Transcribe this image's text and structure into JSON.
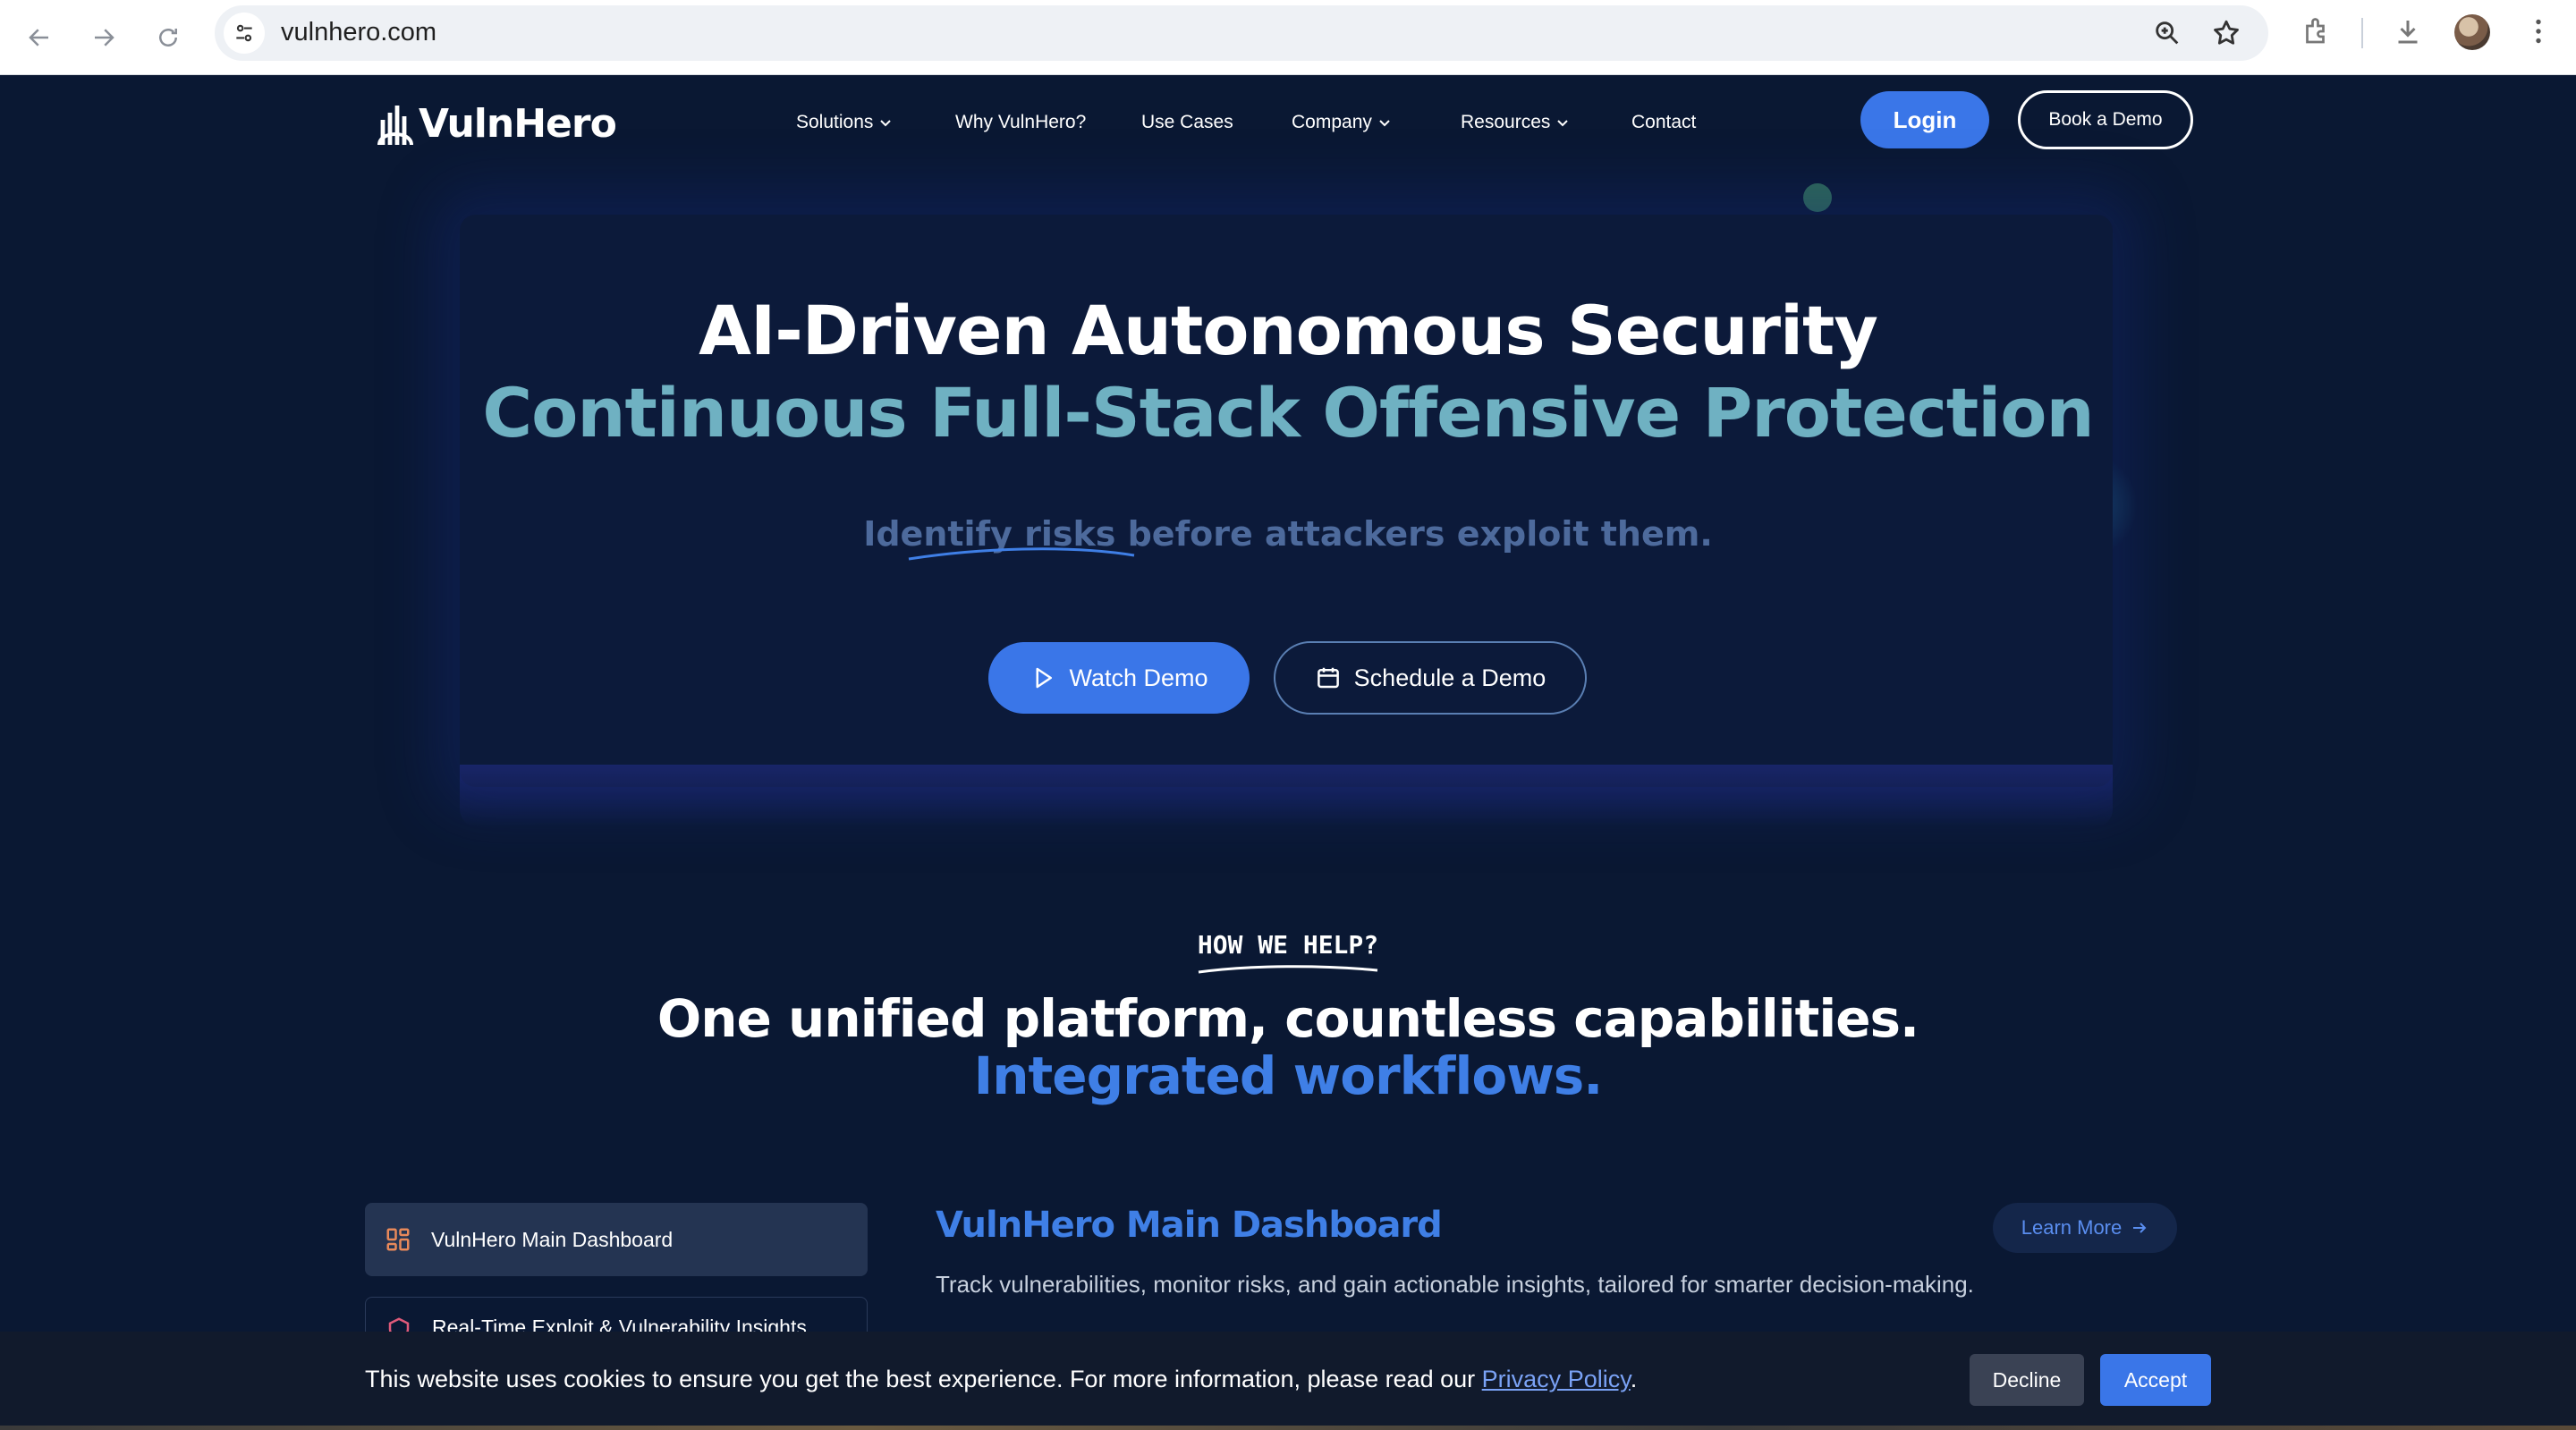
{
  "browser": {
    "url": "vulnhero.com"
  },
  "nav": {
    "logo_text": "VulnHero",
    "items": [
      {
        "label": "Solutions",
        "has_dropdown": true
      },
      {
        "label": "Why VulnHero?",
        "has_dropdown": false
      },
      {
        "label": "Use Cases",
        "has_dropdown": false
      },
      {
        "label": "Company",
        "has_dropdown": true
      },
      {
        "label": "Resources",
        "has_dropdown": true
      },
      {
        "label": "Contact",
        "has_dropdown": false
      }
    ],
    "login_label": "Login",
    "book_demo_label": "Book a Demo"
  },
  "hero": {
    "title_line1": "AI-Driven Autonomous Security",
    "title_line2": "Continuous Full-Stack Offensive Protection",
    "subtitle_struck": "Identify risks",
    "subtitle_rest": " before attackers exploit them.",
    "watch_demo_label": "Watch Demo",
    "schedule_demo_label": "Schedule a Demo"
  },
  "section": {
    "eyebrow": "HOW WE HELP?",
    "title_line1": "One unified platform, countless capabilities.",
    "title_line2": "Integrated workflows."
  },
  "features": {
    "tabs": [
      {
        "label": "VulnHero Main Dashboard"
      },
      {
        "label": "Real-Time Exploit & Vulnerability Insights"
      }
    ],
    "active_title": "VulnHero Main Dashboard",
    "active_description": "Track vulnerabilities, monitor risks, and gain actionable insights, tailored for smarter decision-making.",
    "learn_more_label": "Learn More"
  },
  "cookie_banner": {
    "text": "This website uses cookies to ensure you get the best experience. For more information, please read our ",
    "link_text": "Privacy Policy",
    "suffix": ".",
    "decline_label": "Decline",
    "accept_label": "Accept"
  },
  "colors": {
    "page_bg": "#0a1833",
    "accent_blue": "#3a76e8",
    "teal_heading": "#6fb1c2",
    "section_blue": "#3f7fe6"
  }
}
